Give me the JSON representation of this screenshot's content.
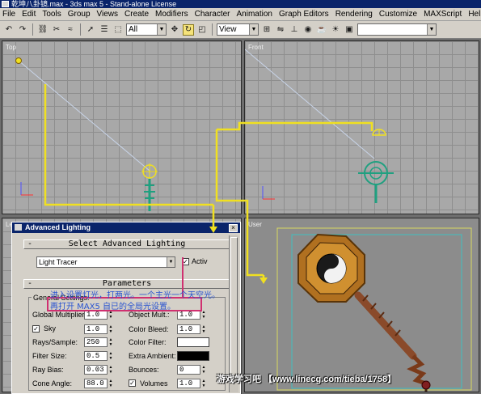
{
  "window": {
    "title": "乾坤八卦镜.max - 3ds max 5 - Stand-alone License"
  },
  "menu": [
    "File",
    "Edit",
    "Tools",
    "Group",
    "Views",
    "Create",
    "Modifiers",
    "Character",
    "Animation",
    "Graph Editors",
    "Rendering",
    "Customize",
    "MAXScript",
    "Help"
  ],
  "toolbar": {
    "selection_filter": "All",
    "reference_coord": "View"
  },
  "viewports": {
    "top": "Top",
    "front": "Front",
    "left": "Le",
    "user": "User"
  },
  "dialog": {
    "title": "Advanced Lighting",
    "rollout_select": "Select Advanced Lighting",
    "plugin": "Light Tracer",
    "active_label": "Activ",
    "active_checked": "✓",
    "rollout_params": "Parameters",
    "group_title": "General Settings:",
    "fields": {
      "global_multiplier": {
        "label": "Global Multiplier:",
        "value": "1.0"
      },
      "object_mult": {
        "label": "Object Mult.:",
        "value": "1.0"
      },
      "sky": {
        "label": "Sky",
        "value": "1.0",
        "checked": "✓"
      },
      "color_bleed": {
        "label": "Color Bleed:",
        "value": "1.0"
      },
      "rays_sample": {
        "label": "Rays/Sample:",
        "value": "250"
      },
      "color_filter": {
        "label": "Color Filter:",
        "color": "#ffffff"
      },
      "filter_size": {
        "label": "Filter Size:",
        "value": "0.5"
      },
      "extra_ambient": {
        "label": "Extra Ambient:",
        "color": "#000000"
      },
      "ray_bias": {
        "label": "Ray Bias:",
        "value": "0.03"
      },
      "bounces": {
        "label": "Bounces:",
        "value": "0"
      },
      "cone_angle": {
        "label": "Cone Angle:",
        "value": "88.0"
      },
      "volumes": {
        "label": "Volumes",
        "value": "1.0",
        "checked": "✓"
      }
    }
  },
  "annotations": {
    "line1": "进入设置灯光，打两光。一个主光一个天空光。",
    "line2": "再打开 MAX5 自已的全局光设置。"
  },
  "watermark": "游戏学习吧  【www.linecg.com/tieba/1758】",
  "colors": {
    "titlebar": "#0a246a",
    "annotation": "#2a54d0",
    "arrow": "#f0e020",
    "highlight_box": "#d03070",
    "light_icon": "#f0e020",
    "model_wire": "#20a080"
  }
}
